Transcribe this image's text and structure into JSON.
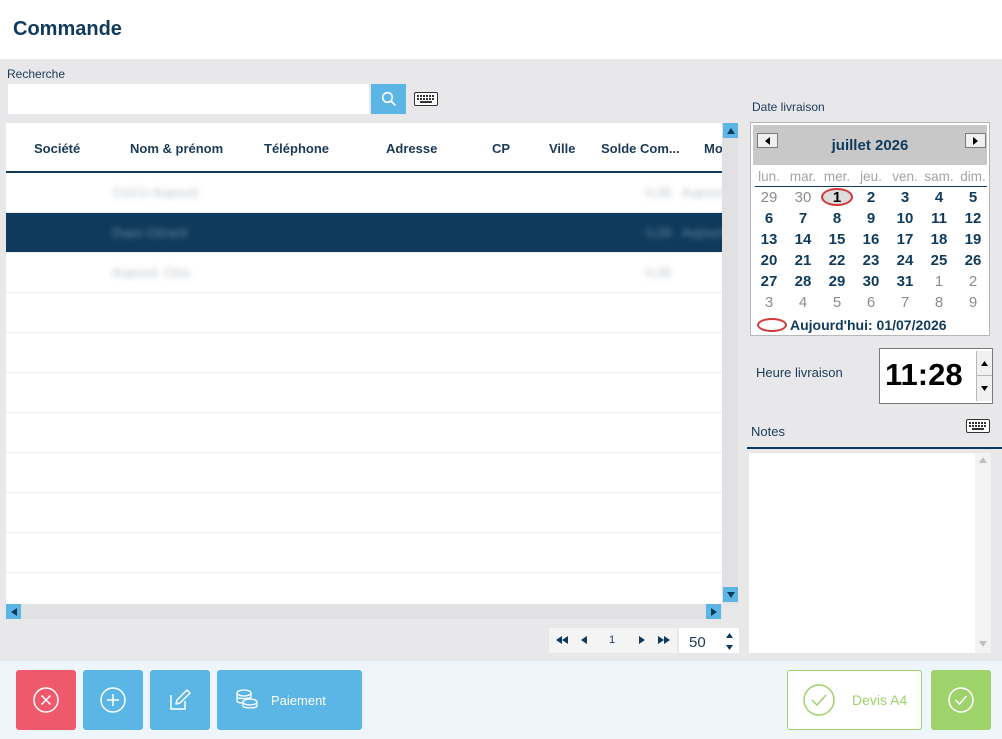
{
  "page": {
    "title": "Commande"
  },
  "search": {
    "label": "Recherche",
    "value": ""
  },
  "grid": {
    "columns": [
      "Société",
      "Nom & prénom",
      "Téléphone",
      "Adresse",
      "CP",
      "Ville",
      "Solde Com...",
      "Mo"
    ],
    "rows": [
      {
        "name": "CUCU Aujourd",
        "balance": "0,00",
        "extra": "Aujourd"
      },
      {
        "name": "Dupo Gérard",
        "balance": "0,00",
        "extra": "Aujourd"
      },
      {
        "name": "Aujourd. Clos",
        "balance": "0,00",
        "extra": ""
      }
    ],
    "selected_row": 1
  },
  "pager": {
    "page": "1",
    "page_size": "50"
  },
  "date": {
    "label": "Date livraison",
    "month": "juillet 2026",
    "weekdays": [
      "lun.",
      "mar.",
      "mer.",
      "jeu.",
      "ven.",
      "sam.",
      "dim."
    ],
    "weeks": [
      [
        "29",
        "30",
        "1",
        "2",
        "3",
        "4",
        "5"
      ],
      [
        "6",
        "7",
        "8",
        "9",
        "10",
        "11",
        "12"
      ],
      [
        "13",
        "14",
        "15",
        "16",
        "17",
        "18",
        "19"
      ],
      [
        "20",
        "21",
        "22",
        "23",
        "24",
        "25",
        "26"
      ],
      [
        "27",
        "28",
        "29",
        "30",
        "31",
        "1",
        "2"
      ],
      [
        "3",
        "4",
        "5",
        "6",
        "7",
        "8",
        "9"
      ]
    ],
    "today_label": "Aujourd'hui: 01/07/2026"
  },
  "time": {
    "label": "Heure livraison",
    "value": "11:28"
  },
  "notes": {
    "label": "Notes",
    "value": ""
  },
  "actions": {
    "payment_label": "Paiement",
    "quote_label": "Devis A4"
  },
  "colors": {
    "navy": "#0f3a5c",
    "accent_blue": "#5bb6e6",
    "cancel_red": "#ee5a6c",
    "confirm_green": "#9ed26b"
  },
  "icons": {
    "search": "search-icon",
    "keyboard": "keyboard-icon",
    "cancel": "close-circle-icon",
    "add": "plus-circle-icon",
    "edit": "edit-icon",
    "payment": "coins-icon",
    "confirm": "check-circle-icon"
  }
}
